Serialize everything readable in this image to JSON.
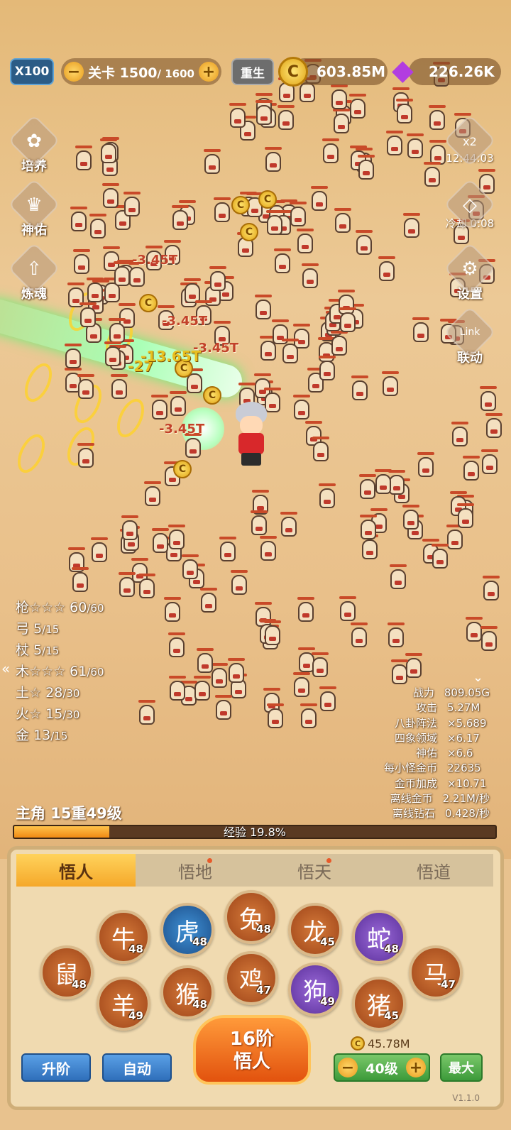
{
  "top_bar": {
    "speed_label": "X100",
    "level_label": "关卡",
    "level_current": "1500",
    "level_max": "/ 1600",
    "minus": "−",
    "plus": "+",
    "rebirth_label": "重生",
    "gold": "603.85M",
    "gems": "226.26K"
  },
  "left_menu": [
    {
      "label": "培养",
      "icon": "cultivate-icon"
    },
    {
      "label": "神佑",
      "icon": "blessing-icon"
    },
    {
      "label": "炼魂",
      "icon": "soul-refine-icon"
    }
  ],
  "right_menu": {
    "boost_label": "x2",
    "boost_timer": "12:44:03",
    "cooldown_label": "冷却 0:08",
    "settings_label": "设置",
    "link_label": "联动"
  },
  "damage_numbers": [
    "-3.45T",
    "-3.45T",
    "-3.45T",
    "-3.45T",
    "-27",
    "-13.65T"
  ],
  "weapon_stats": [
    {
      "name": "枪",
      "stars": "☆☆☆",
      "level": "60",
      "max": "/60"
    },
    {
      "name": "弓",
      "stars": "",
      "level": "5",
      "max": "/15"
    },
    {
      "name": "杖",
      "stars": "",
      "level": "5",
      "max": "/15"
    },
    {
      "name": "木",
      "stars": "☆☆☆",
      "level": "61",
      "max": "/60"
    },
    {
      "name": "土",
      "stars": "☆",
      "level": "28",
      "max": "/30"
    },
    {
      "name": "火",
      "stars": "☆",
      "level": "15",
      "max": "/30"
    },
    {
      "name": "金",
      "stars": "",
      "level": "13",
      "max": "/15"
    }
  ],
  "power_stats": [
    {
      "label": "战力",
      "value": "809.05G"
    },
    {
      "label": "攻击",
      "value": "5.27M"
    },
    {
      "label": "八卦阵法",
      "value": "×5.689"
    },
    {
      "label": "四象领域",
      "value": "×6.17"
    },
    {
      "label": "神佑",
      "value": "×6.6"
    },
    {
      "label": "每小怪金币",
      "value": "22635"
    },
    {
      "label": "金币加成",
      "value": "×10.71"
    },
    {
      "label": "离线金币",
      "value": "2.21M/秒"
    },
    {
      "label": "离线钻石",
      "value": "0.428/秒"
    }
  ],
  "hero": {
    "title": "主角 15重49级",
    "exp_label": "经验 19.8%",
    "exp_fraction": 0.198
  },
  "tabs": [
    {
      "label": "悟人",
      "active": true,
      "dot": false
    },
    {
      "label": "悟地",
      "active": false,
      "dot": true
    },
    {
      "label": "悟天",
      "active": false,
      "dot": true
    },
    {
      "label": "悟道",
      "active": false,
      "dot": false
    }
  ],
  "zodiacs": [
    {
      "icon": "rat-icon",
      "glyph": "鼠",
      "level": "48",
      "color": "brown"
    },
    {
      "icon": "ox-icon",
      "glyph": "牛",
      "level": "48",
      "color": "brown"
    },
    {
      "icon": "tiger-icon",
      "glyph": "虎",
      "level": "48",
      "color": "blue"
    },
    {
      "icon": "rabbit-icon",
      "glyph": "兔",
      "level": "48",
      "color": "brown"
    },
    {
      "icon": "dragon-icon",
      "glyph": "龙",
      "level": "45",
      "color": "brown"
    },
    {
      "icon": "snake-icon",
      "glyph": "蛇",
      "level": "48",
      "color": "purple"
    },
    {
      "icon": "horse-icon",
      "glyph": "马",
      "level": "47",
      "color": "brown"
    },
    {
      "icon": "goat-icon",
      "glyph": "羊",
      "level": "49",
      "color": "brown"
    },
    {
      "icon": "monkey-icon",
      "glyph": "猴",
      "level": "48",
      "color": "brown"
    },
    {
      "icon": "rooster-icon",
      "glyph": "鸡",
      "level": "47",
      "color": "brown"
    },
    {
      "icon": "dog-icon",
      "glyph": "狗",
      "level": "49",
      "color": "purple"
    },
    {
      "icon": "pig-icon",
      "glyph": "猪",
      "level": "45",
      "color": "brown"
    }
  ],
  "actions": {
    "big_button_line1": "16阶",
    "big_button_line2": "悟人",
    "upgrade_label": "升阶",
    "auto_label": "自动",
    "cost": "45.78M",
    "level_step": "40级",
    "max_label": "最大",
    "version": "V1.1.0"
  },
  "colors": {
    "accent": "#f5a82a",
    "button_blue": "#2f6fba",
    "button_green": "#3c9a3a",
    "damage_red": "#c2412a"
  }
}
